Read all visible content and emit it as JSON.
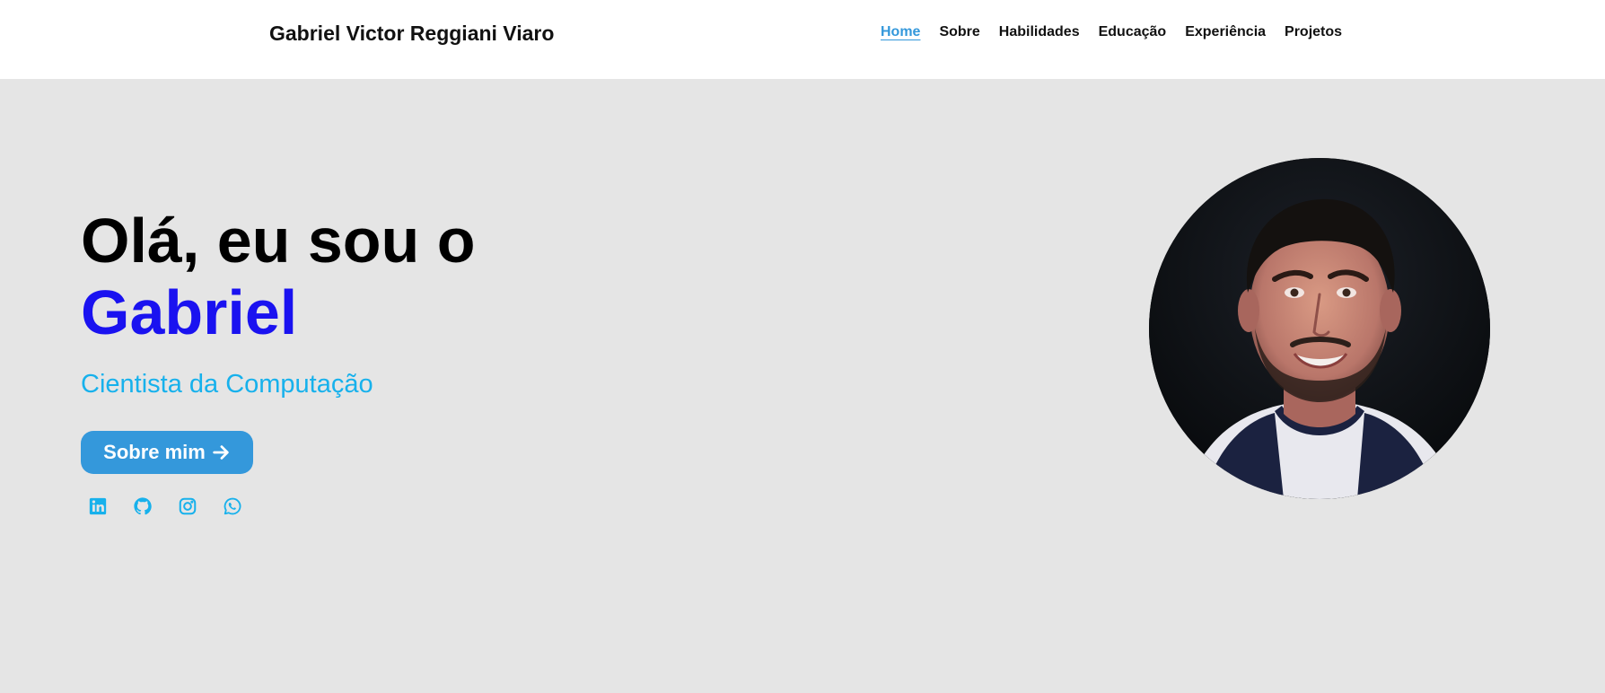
{
  "header": {
    "brand": "Gabriel Victor Reggiani Viaro",
    "nav": [
      {
        "label": "Home",
        "active": true
      },
      {
        "label": "Sobre",
        "active": false
      },
      {
        "label": "Habilidades",
        "active": false
      },
      {
        "label": "Educação",
        "active": false
      },
      {
        "label": "Experiência",
        "active": false
      },
      {
        "label": "Projetos",
        "active": false
      }
    ]
  },
  "hero": {
    "greeting": "Olá, eu sou o",
    "name": "Gabriel",
    "role": "Cientista da Computação",
    "cta_label": "Sobre mim",
    "socials": [
      {
        "icon": "linkedin-icon"
      },
      {
        "icon": "github-icon"
      },
      {
        "icon": "instagram-icon"
      },
      {
        "icon": "whatsapp-icon"
      }
    ]
  },
  "colors": {
    "accent": "#3498db",
    "name": "#1a12f0",
    "role": "#17b1ec",
    "background": "#e5e5e5"
  }
}
